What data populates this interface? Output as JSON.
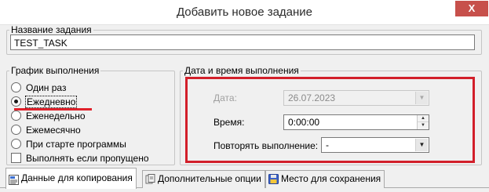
{
  "window": {
    "title": "Добавить новое задание",
    "close_symbol": "X"
  },
  "task_name": {
    "legend": "Название задания",
    "value": "TEST_TASK"
  },
  "schedule": {
    "legend": "График выполнения",
    "options": [
      {
        "label": "Один раз",
        "selected": false
      },
      {
        "label": "Ежедневно",
        "selected": true
      },
      {
        "label": "Еженедельно",
        "selected": false
      },
      {
        "label": "Ежемесячно",
        "selected": false
      },
      {
        "label": "При старте программы",
        "selected": false
      }
    ],
    "run_if_missed": {
      "label": "Выполнять если пропущено",
      "checked": false
    }
  },
  "datetime": {
    "legend": "Дата и время выполнения",
    "date": {
      "label": "Дата:",
      "value": "26.07.2023",
      "enabled": false
    },
    "time": {
      "label": "Время:",
      "value": "0:00:00"
    },
    "repeat": {
      "label": "Повторять выполнение:",
      "value": "-"
    }
  },
  "tabs": [
    {
      "label": "Данные для копирования",
      "icon": "copy-data-icon",
      "active": true
    },
    {
      "label": "Дополнительные опции",
      "icon": "options-icon",
      "active": false
    },
    {
      "label": "Место для сохранения",
      "icon": "save-location-icon",
      "active": false
    }
  ],
  "colors": {
    "highlight": "#d21f2a",
    "underline": "#e0222b",
    "close_button": "#c7504b"
  }
}
